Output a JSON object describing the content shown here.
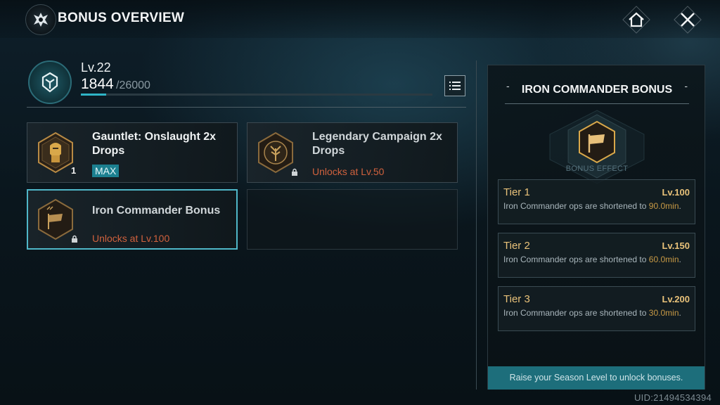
{
  "header": {
    "title": "BONUS OVERVIEW",
    "home_icon": "home-icon",
    "close_icon": "close-icon"
  },
  "season": {
    "level_text": "Lv.22",
    "xp_current": "1844",
    "xp_max": "/26000",
    "xp_progress": 0.071
  },
  "bonuses": [
    {
      "title": "Gauntlet: Onslaught 2x Drops",
      "count": "1",
      "tag": "MAX",
      "icon": "armored-knight-icon",
      "locked": false
    },
    {
      "title": "Legendary Campaign 2x Drops",
      "unlock": "Unlocks at Lv.50",
      "icon": "tree-emblem-icon",
      "locked": true
    },
    {
      "title": "Iron Commander Bonus",
      "unlock": "Unlocks at Lv.100",
      "icon": "flag-icon",
      "locked": true,
      "selected": true
    }
  ],
  "panel": {
    "title": "IRON COMMANDER BONUS",
    "dash_left": "-",
    "dash_right": "-",
    "effect_label": "BONUS EFFECT",
    "tiers": [
      {
        "name": "Tier 1",
        "level": "Lv.100",
        "desc": "Iron Commander ops are shortened to",
        "value": "90.0min",
        "suffix": "."
      },
      {
        "name": "Tier 2",
        "level": "Lv.150",
        "desc": "Iron Commander ops are shortened to",
        "value": "60.0min",
        "suffix": "."
      },
      {
        "name": "Tier 3",
        "level": "Lv.200",
        "desc": "Iron Commander ops are shortened to",
        "value": "30.0min",
        "suffix": "."
      }
    ],
    "footer": "Raise your Season Level to unlock bonuses."
  },
  "uid": "UID:21494534394",
  "colors": {
    "accent": "#2fb4c6",
    "gold": "#e9c27a",
    "locked_red": "#d0613d",
    "footer_bg": "#1d6e7b"
  }
}
